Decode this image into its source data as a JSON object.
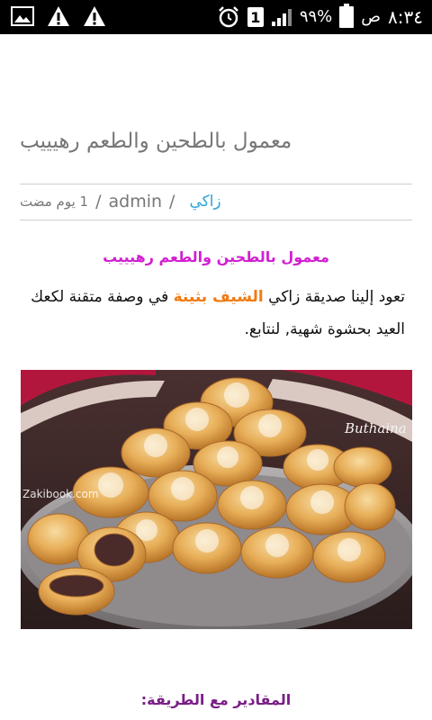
{
  "status_bar": {
    "icons_left": [
      "image-icon",
      "warning-icon",
      "warning-icon"
    ],
    "sim_slot": "1",
    "battery_text": "٩٩%",
    "time": "٨:٣٤",
    "am_pm": "ص"
  },
  "article": {
    "title": "معمول بالطحين والطعم رهيييب",
    "meta": {
      "category": "زاكي",
      "author": "admin",
      "time_ago": "1 يوم مضت"
    },
    "subtitle": "معمول بالطحين والطعم رهيييب",
    "intro_before": "تعود إلينا صديقة زاكي ",
    "intro_highlight": "الشيف بثينة",
    "intro_after": " في وصفة متقنة لكعك العيد بحشوة شهية, لنتابع.",
    "image": {
      "watermark_site": "Zakibook.com",
      "watermark_author": "Buthaina"
    },
    "section_heading": "المقادير مع الطريقة:"
  },
  "colors": {
    "link_category": "#2ea3d8",
    "subtitle": "#d21fd2",
    "highlight": "#f07b13",
    "section": "#7a1d86"
  }
}
